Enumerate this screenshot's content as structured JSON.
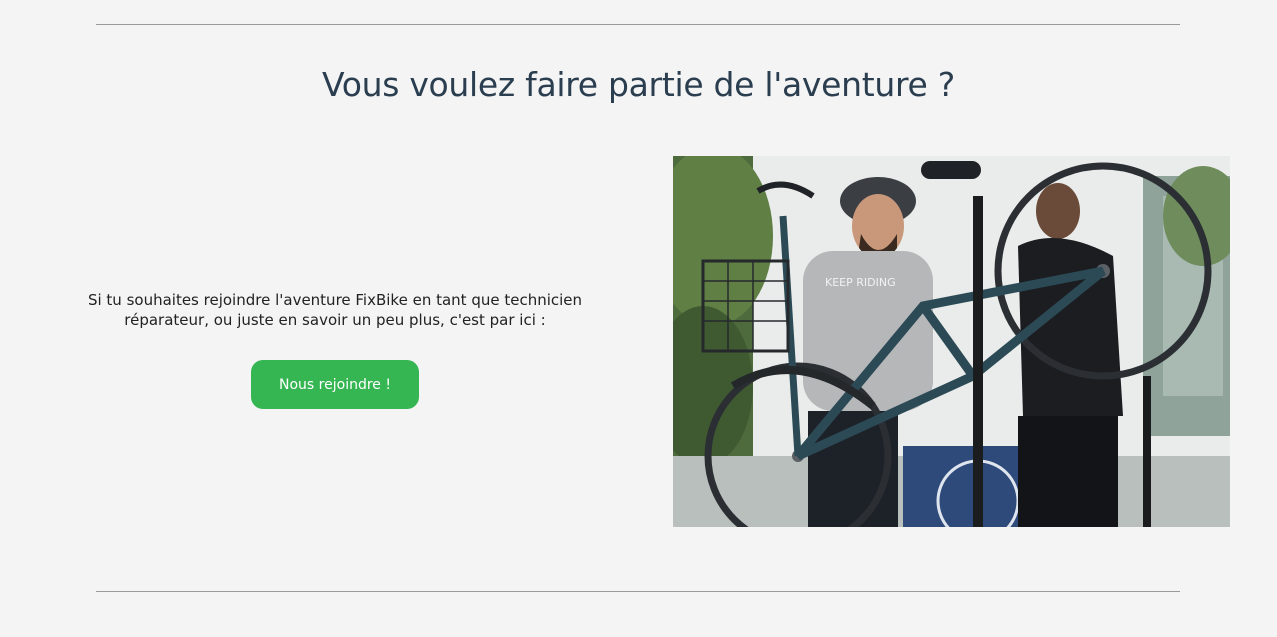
{
  "section": {
    "title": "Vous voulez faire partie de l'aventure ?",
    "intro": "Si tu souhaites rejoindre l'aventure FixBike en tant que technicien réparateur, ou juste en savoir un peu plus, c'est par ici :",
    "cta_label": "Nous rejoindre !"
  },
  "photo": {
    "sweater_print": "KEEP RIDING"
  },
  "colors": {
    "background": "#f4f4f4",
    "title": "#2b3e50",
    "cta": "#35b653",
    "rule": "#9a9a9a"
  }
}
